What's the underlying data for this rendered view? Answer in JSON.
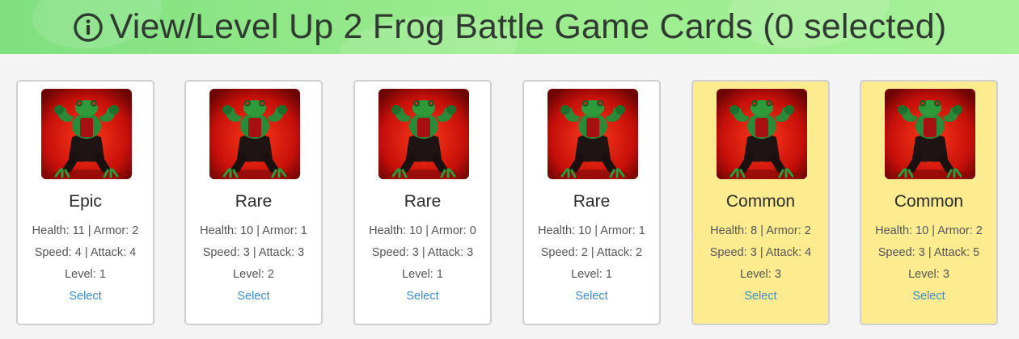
{
  "header": {
    "title": "View/Level Up 2 Frog Battle Game Cards (0 selected)",
    "icon": "info-icon"
  },
  "cards": [
    {
      "rarity": "Epic",
      "stats_line1": "Health: 11 | Armor: 2",
      "stats_line2": "Speed: 4 | Attack: 4",
      "level": "Level: 1",
      "select_label": "Select"
    },
    {
      "rarity": "Rare",
      "stats_line1": "Health: 10 | Armor: 1",
      "stats_line2": "Speed: 3 | Attack: 3",
      "level": "Level: 2",
      "select_label": "Select"
    },
    {
      "rarity": "Rare",
      "stats_line1": "Health: 10 | Armor: 0",
      "stats_line2": "Speed: 3 | Attack: 3",
      "level": "Level: 1",
      "select_label": "Select"
    },
    {
      "rarity": "Rare",
      "stats_line1": "Health: 10 | Armor: 1",
      "stats_line2": "Speed: 2 | Attack: 2",
      "level": "Level: 1",
      "select_label": "Select"
    },
    {
      "rarity": "Common",
      "stats_line1": "Health: 8 | Armor: 2",
      "stats_line2": "Speed: 3 | Attack: 4",
      "level": "Level: 3",
      "select_label": "Select"
    },
    {
      "rarity": "Common",
      "stats_line1": "Health: 10 | Armor: 2",
      "stats_line2": "Speed: 3 | Attack: 5",
      "level": "Level: 3",
      "select_label": "Select"
    }
  ],
  "colors": {
    "header_green": "#8de88a",
    "common_card_bg": "#fdeb90",
    "default_card_bg": "#ffffff",
    "link_blue": "#3f8ccc",
    "image_red": "#d8180f"
  }
}
